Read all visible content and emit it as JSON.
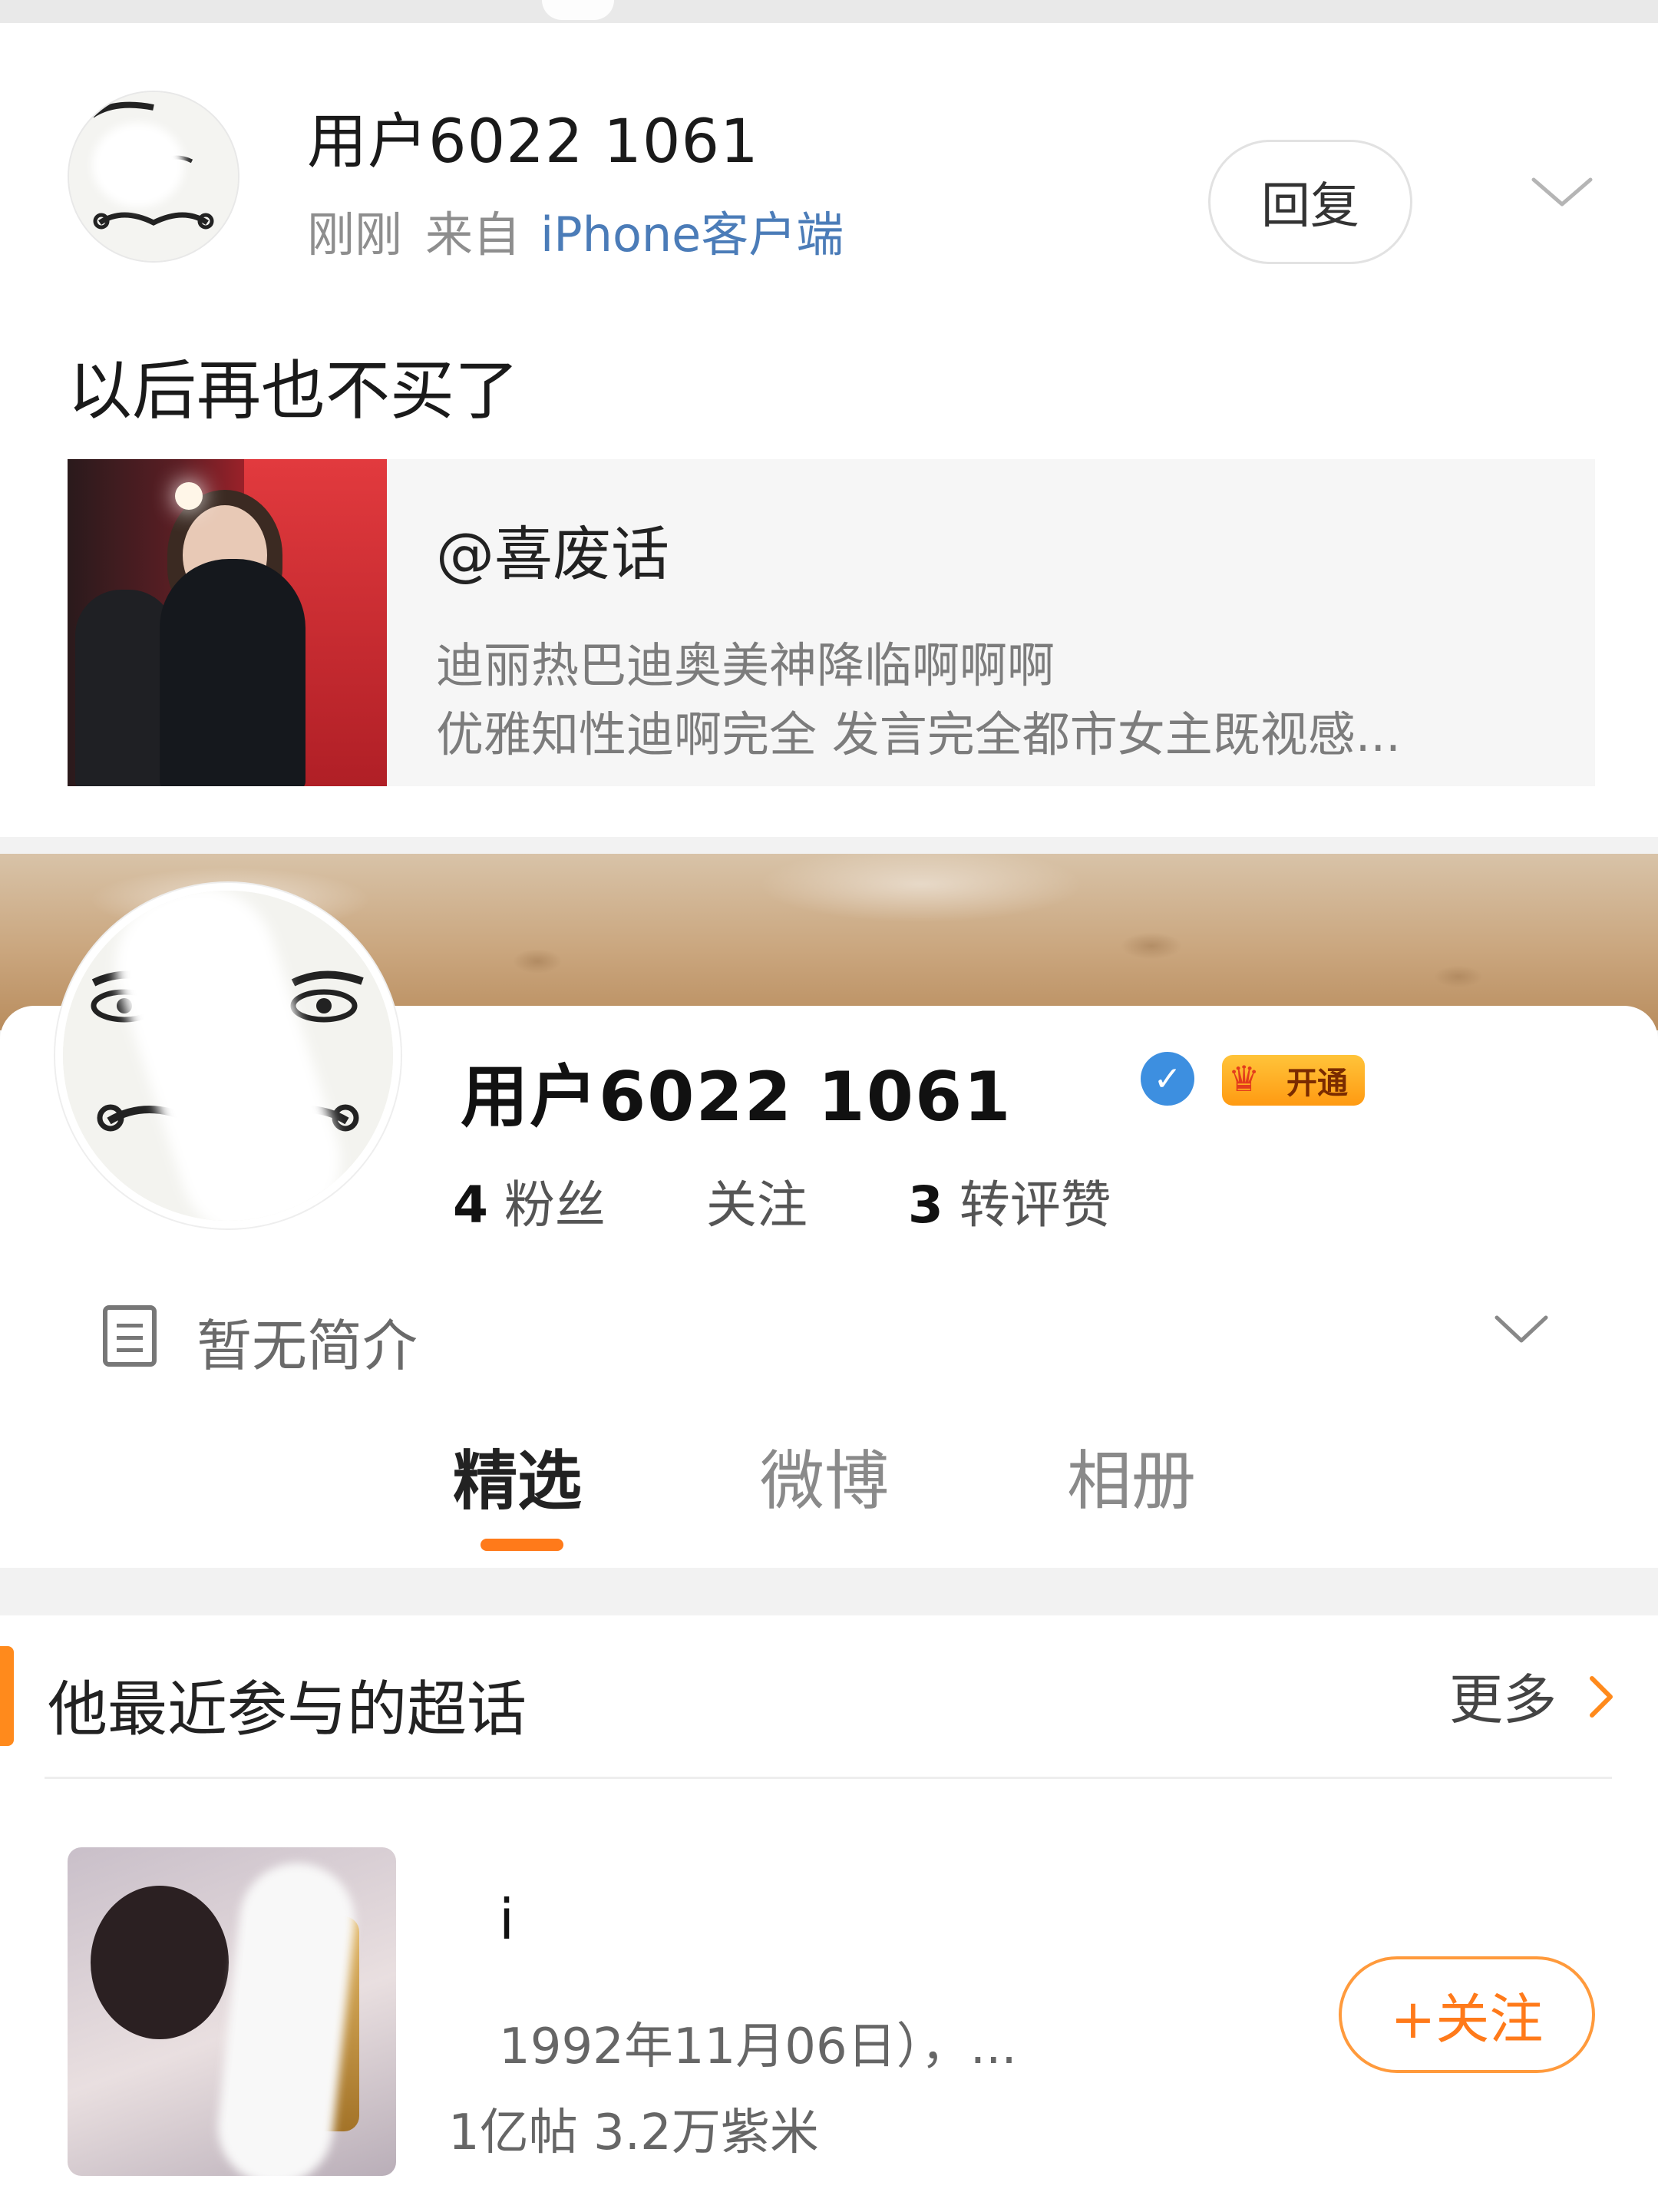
{
  "comment": {
    "username": "用户6022 1061",
    "time": "刚刚",
    "from_label": "来自",
    "source": "iPhone客户端",
    "reply_label": "回复",
    "text": "以后再也不买了",
    "quote": {
      "author": "@喜废话",
      "line1": "迪丽热巴迪奥美神降临啊啊啊",
      "line2": "优雅知性迪啊完全 发言完全都市女主既视感..."
    }
  },
  "profile": {
    "name": "用户6022 1061",
    "vip_label": "开通",
    "stats": {
      "fans_count": "4",
      "fans_label": "粉丝",
      "follow_count": "",
      "follow_label": "关注",
      "interact_count": "3",
      "interact_label": "转评赞"
    },
    "bio": "暂无简介",
    "tabs": [
      "精选",
      "微博",
      "相册"
    ]
  },
  "super_topic": {
    "section_title": "他最近参与的超话",
    "more_label": "更多",
    "item": {
      "name": "i",
      "desc": "1992年11月06日），...",
      "stats": "1亿帖 3.2万紫米",
      "follow_label": "+关注"
    }
  },
  "colors": {
    "accent": "#ff7a1a",
    "link": "#4b7cb8",
    "verify": "#3d8fe0"
  }
}
